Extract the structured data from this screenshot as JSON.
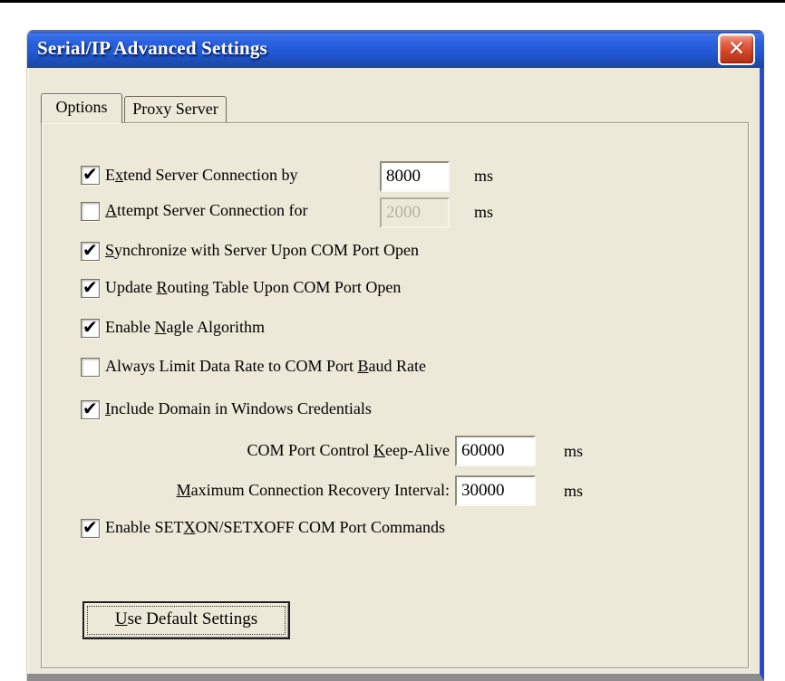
{
  "window": {
    "title": "Serial/IP Advanced Settings"
  },
  "icons": {
    "close": "✕",
    "checkmark": "✔"
  },
  "tabs": {
    "options": "Options",
    "proxy": "Proxy Server"
  },
  "form": {
    "extend": {
      "pre": "E",
      "key": "x",
      "post": "tend Server Connection by",
      "checked": true,
      "value": "8000",
      "unit": "ms"
    },
    "attempt": {
      "pre": "",
      "key": "A",
      "post": "ttempt Server Connection for",
      "checked": false,
      "disabled": true,
      "value": "2000",
      "unit": "ms"
    },
    "sync": {
      "pre": "",
      "key": "S",
      "post": "ynchronize with Server Upon COM Port Open",
      "checked": true
    },
    "routing": {
      "pre": "Update ",
      "key": "R",
      "post": "outing Table Upon COM Port Open",
      "checked": true
    },
    "nagle": {
      "pre": "Enable ",
      "key": "N",
      "post": "agle Algorithm",
      "checked": true
    },
    "baud": {
      "pre": "Always Limit Data Rate to COM Port ",
      "key": "B",
      "post": "aud Rate",
      "checked": false
    },
    "domain": {
      "pre": "",
      "key": "I",
      "post": "nclude Domain in Windows Credentials",
      "checked": true
    },
    "keepalive": {
      "pre": "COM Port Control ",
      "key": "K",
      "post": "eep-Alive",
      "value": "60000",
      "unit": "ms"
    },
    "recovery": {
      "pre": "",
      "key": "M",
      "post": "aximum Connection Recovery Interval:",
      "value": "30000",
      "unit": "ms"
    },
    "setxon": {
      "pre": "Enable SET",
      "key": "X",
      "post": "ON/SETXOFF COM Port Commands",
      "checked": true
    }
  },
  "buttons": {
    "use_default": {
      "pre": "",
      "key": "U",
      "post": "se Default Settings"
    }
  },
  "colors": {
    "titlebar_blue": "#2a5fdc",
    "dialog_bg": "#ece9d8",
    "close_red": "#d2492b",
    "window_border_blue": "#2b49cf",
    "disabled_text": "#b5b2a0",
    "bottom_edge_gray": "#8d8d8d"
  }
}
